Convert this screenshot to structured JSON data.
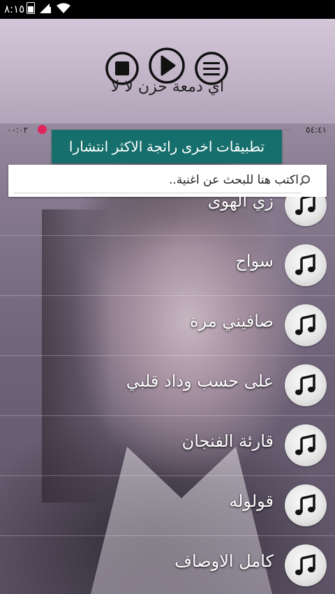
{
  "status_bar": {
    "time": "٨:١٥"
  },
  "player": {
    "song_title": "اي دمعة حزن لا لا",
    "elapsed": "٠٠:٠٢",
    "duration": "٥٤:٤١",
    "progress": 0.0006,
    "icons": [
      "stop-icon",
      "play-icon",
      "menu-icon"
    ]
  },
  "promo": {
    "label": "تطبيقات اخرى رائجة الاكثر انتشارا"
  },
  "search": {
    "placeholder": "اكتب هنا للبحث عن اغنية.."
  },
  "songs": [
    "زي الهوى",
    "سواح",
    "صافيني مرة",
    "على حسب وداد قلبي",
    "قارئة الفنجان",
    "قولوله",
    "كامل الاوصاف"
  ],
  "colors": {
    "promo_bg": "#166f6c",
    "seek_thumb": "#e0245e"
  }
}
